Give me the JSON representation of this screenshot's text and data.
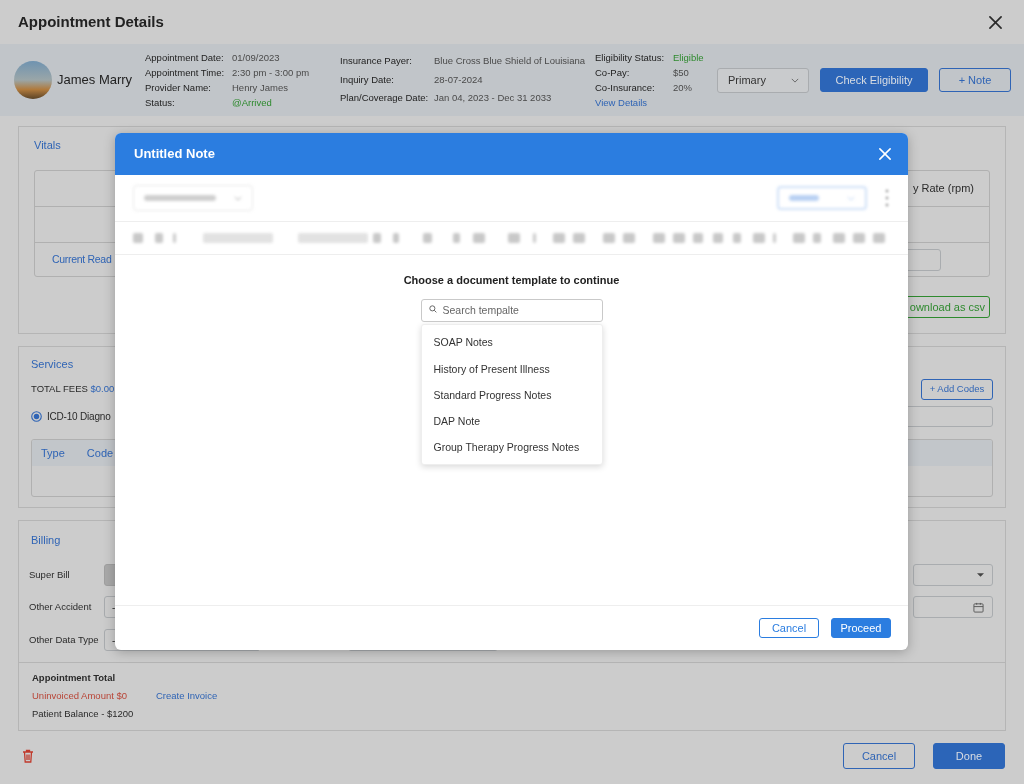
{
  "window": {
    "title": "Appointment Details"
  },
  "patient": {
    "name": "James Marry"
  },
  "appointment": [
    {
      "label": "Appointment Date:",
      "value": "01/09/2023",
      "kind": "text"
    },
    {
      "label": "Appointment Time:",
      "value": "2:30 pm - 3:00 pm",
      "kind": "text"
    },
    {
      "label": "Provider Name:",
      "value": "Henry James",
      "kind": "text"
    },
    {
      "label": "Status:",
      "value": "@Arrived",
      "kind": "status"
    }
  ],
  "insurance": [
    {
      "label": "Insurance Payer:",
      "value": "Blue Cross Blue Shield of Louisiana"
    },
    {
      "label": "Inquiry Date:",
      "value": "28-07-2024"
    },
    {
      "label": "Plan/Coverage Date:",
      "value": "Jan 04, 2023 - Dec 31 2033"
    }
  ],
  "eligibility": {
    "rows": [
      {
        "label": "Eligibility Status:",
        "value": "Eligible",
        "kind": "status"
      },
      {
        "label": "Co-Pay:",
        "value": "$50",
        "kind": "text"
      },
      {
        "label": "Co-Insurance:",
        "value": "20%",
        "kind": "text"
      }
    ],
    "link": "View Details"
  },
  "coverage_select": {
    "value": "Primary"
  },
  "header_buttons": [
    {
      "label": "Check Eligibility",
      "kind": "primary"
    },
    {
      "label": "+ Note",
      "kind": "outline"
    }
  ],
  "vitals": {
    "title": "Vitals",
    "row_label": "Current Read",
    "column_label": "y Rate (rpm)",
    "download_button": "ownload as csv"
  },
  "services": {
    "title": "Services",
    "total_label": "TOTAL FEES",
    "total_value": "$0.00",
    "add_button": "+ Add Codes",
    "code_option": {
      "label": "ICD-10 Diagno",
      "selected": true
    },
    "columns": [
      "Type",
      "Code"
    ]
  },
  "billing": {
    "title": "Billing",
    "fields": [
      {
        "label": "Super Bill",
        "kind": "input",
        "disabled": true
      },
      {
        "label": "Other Accident",
        "kind": "input",
        "value": "-",
        "disabled": false
      },
      {
        "label": "Other Data Type",
        "kind": "input_pair",
        "value": "-",
        "disabled": false
      }
    ],
    "right_fields": [
      {
        "kind": "select"
      },
      {
        "kind": "date"
      }
    ]
  },
  "appointment_total": {
    "title": "Appointment Total",
    "uninvoiced": "Uninvoiced Amount $0",
    "create_invoice": "Create Invoice",
    "balance": "Patient Balance - $1200"
  },
  "footer_buttons": [
    {
      "label": "Cancel",
      "kind": "outline"
    },
    {
      "label": "Done",
      "kind": "primary"
    }
  ],
  "modal": {
    "title": "Untitled Note",
    "prompt": "Choose a document template to continue",
    "search": {
      "placeholder": "Search tempalte"
    },
    "templates": [
      "SOAP Notes",
      "History of Present Illness",
      "Standard Progress Notes",
      "DAP Note",
      "Group Therapy Progress Notes"
    ],
    "buttons": [
      {
        "label": "Cancel",
        "kind": "outline"
      },
      {
        "label": "Proceed",
        "kind": "primary"
      }
    ]
  }
}
